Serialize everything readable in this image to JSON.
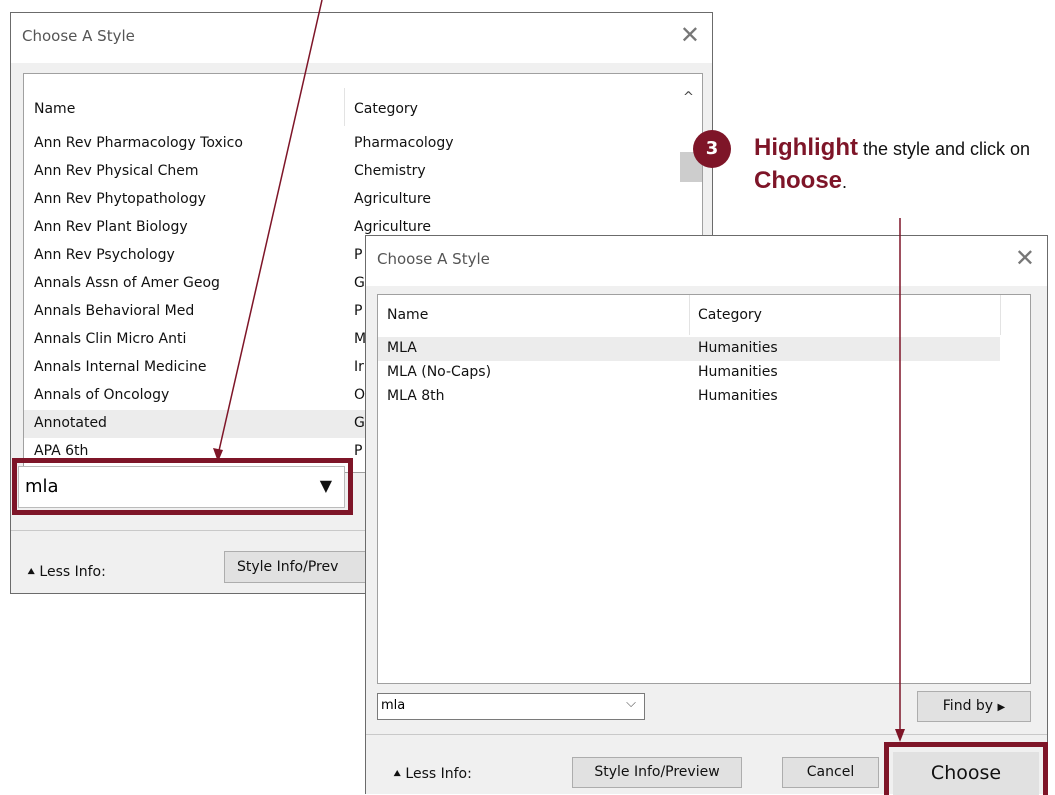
{
  "instruction": {
    "step_number": "3",
    "highlight_word": "Highlight",
    "text_part1": " the style and click on ",
    "choose_word": "Choose",
    "period": "."
  },
  "dialog_back": {
    "title": "Choose A Style",
    "close_icon": "close-icon",
    "columns": {
      "name": "Name",
      "category": "Category"
    },
    "rows": [
      {
        "name": "Ann Rev Pharmacology Toxico",
        "category": "Pharmacology"
      },
      {
        "name": "Ann Rev Physical Chem",
        "category": "Chemistry"
      },
      {
        "name": "Ann Rev Phytopathology",
        "category": "Agriculture"
      },
      {
        "name": "Ann Rev Plant Biology",
        "category": "Agriculture"
      },
      {
        "name": "Ann Rev Psychology",
        "category": "P"
      },
      {
        "name": "Annals Assn of Amer Geog",
        "category": "G"
      },
      {
        "name": "Annals Behavioral Med",
        "category": "P"
      },
      {
        "name": "Annals Clin Micro Anti",
        "category": "M"
      },
      {
        "name": "Annals Internal Medicine",
        "category": "Ir"
      },
      {
        "name": "Annals of Oncology",
        "category": "O"
      },
      {
        "name": "Annotated",
        "category": "G"
      },
      {
        "name": "APA 6th",
        "category": "P"
      }
    ],
    "selected_row": "Annotated",
    "search_value": "mla",
    "less_info": "Less Info:",
    "style_info_button": "Style Info/Prev"
  },
  "dialog_front": {
    "title": "Choose A Style",
    "close_icon": "close-icon",
    "columns": {
      "name": "Name",
      "category": "Category"
    },
    "rows": [
      {
        "name": "MLA",
        "category": "Humanities"
      },
      {
        "name": "MLA (No-Caps)",
        "category": "Humanities"
      },
      {
        "name": "MLA 8th",
        "category": "Humanities"
      }
    ],
    "selected_row": "MLA",
    "search_value": "mla",
    "find_by_button": "Find by",
    "less_info": "Less Info:",
    "style_info_button": "Style Info/Preview",
    "cancel_button": "Cancel",
    "choose_button": "Choose"
  },
  "colors": {
    "accent": "#7e1528",
    "selected_row": "#ececec",
    "dialog_bg": "#f0f0f0"
  }
}
